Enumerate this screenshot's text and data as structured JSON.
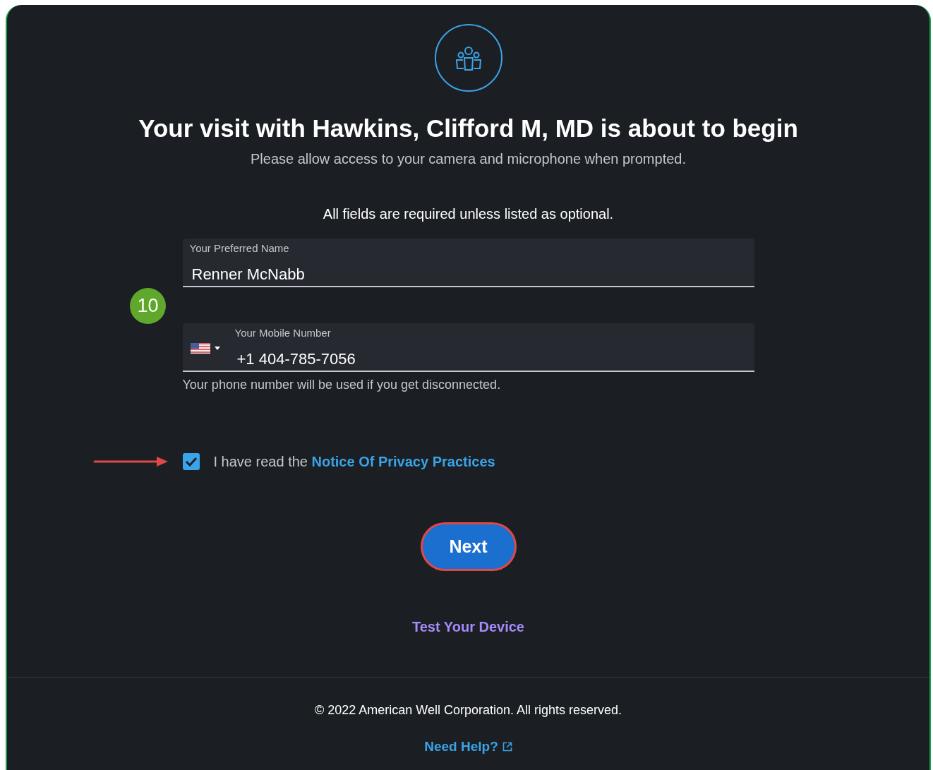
{
  "header": {
    "title": "Your visit with Hawkins, Clifford M, MD is about to begin",
    "subtitle": "Please allow access to your camera and microphone when prompted."
  },
  "required_note": "All fields are required unless listed as optional.",
  "fields": [
    {
      "kind": "text",
      "label": "Your Preferred Name",
      "value": "Renner McNabb"
    },
    {
      "kind": "phone",
      "label": "Your Mobile Number",
      "value": "+1 404-785-7056",
      "helper": "Your phone number will be used if you get disconnected."
    }
  ],
  "step_badge": "10",
  "consent": {
    "checked": true,
    "text": "I have read the ",
    "link": "Notice Of Privacy Practices"
  },
  "next_button": {
    "label": "Next"
  },
  "test_link": "Test Your Device",
  "footer": {
    "copyright": "© 2022 American Well Corporation. All rights reserved.",
    "help_link": "Need Help?"
  }
}
